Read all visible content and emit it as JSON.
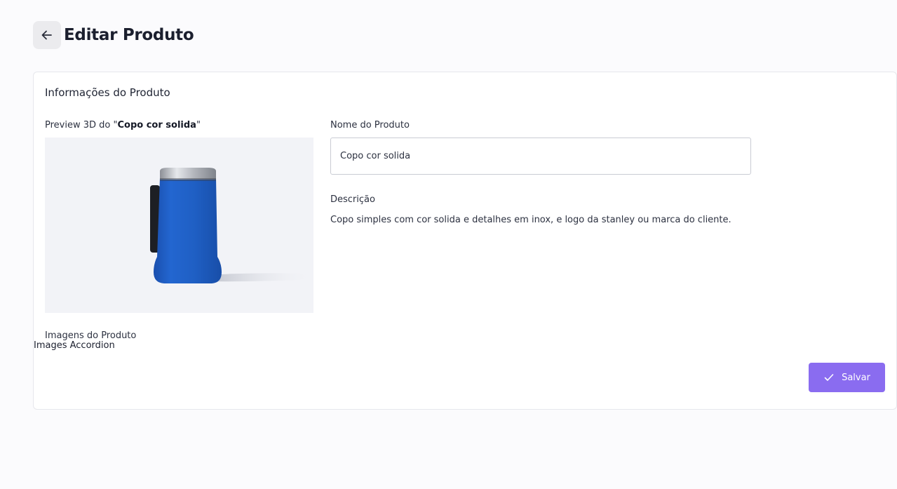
{
  "header": {
    "back_icon": "arrow-left-icon",
    "title": "Editar Produto"
  },
  "card": {
    "title": "Informações do Produto",
    "preview": {
      "label_prefix": "Preview 3D do \"",
      "product_name": "Copo cor solida",
      "label_suffix": "\""
    },
    "images_label": "Imagens do Produto",
    "accordion_label": "Images Accordion",
    "name_field": {
      "label": "Nome do Produto",
      "value": "Copo cor solida"
    },
    "description": {
      "label": "Descrição",
      "text": "Copo simples com cor solida e detalhes em inox, e logo da stanley ou marca do cliente."
    },
    "save_button": {
      "icon": "check-icon",
      "label": "Salvar"
    }
  },
  "colors": {
    "accent": "#8a6cf0",
    "cup_body": "#1f5fc4",
    "page_bg": "#fbfbfd"
  }
}
